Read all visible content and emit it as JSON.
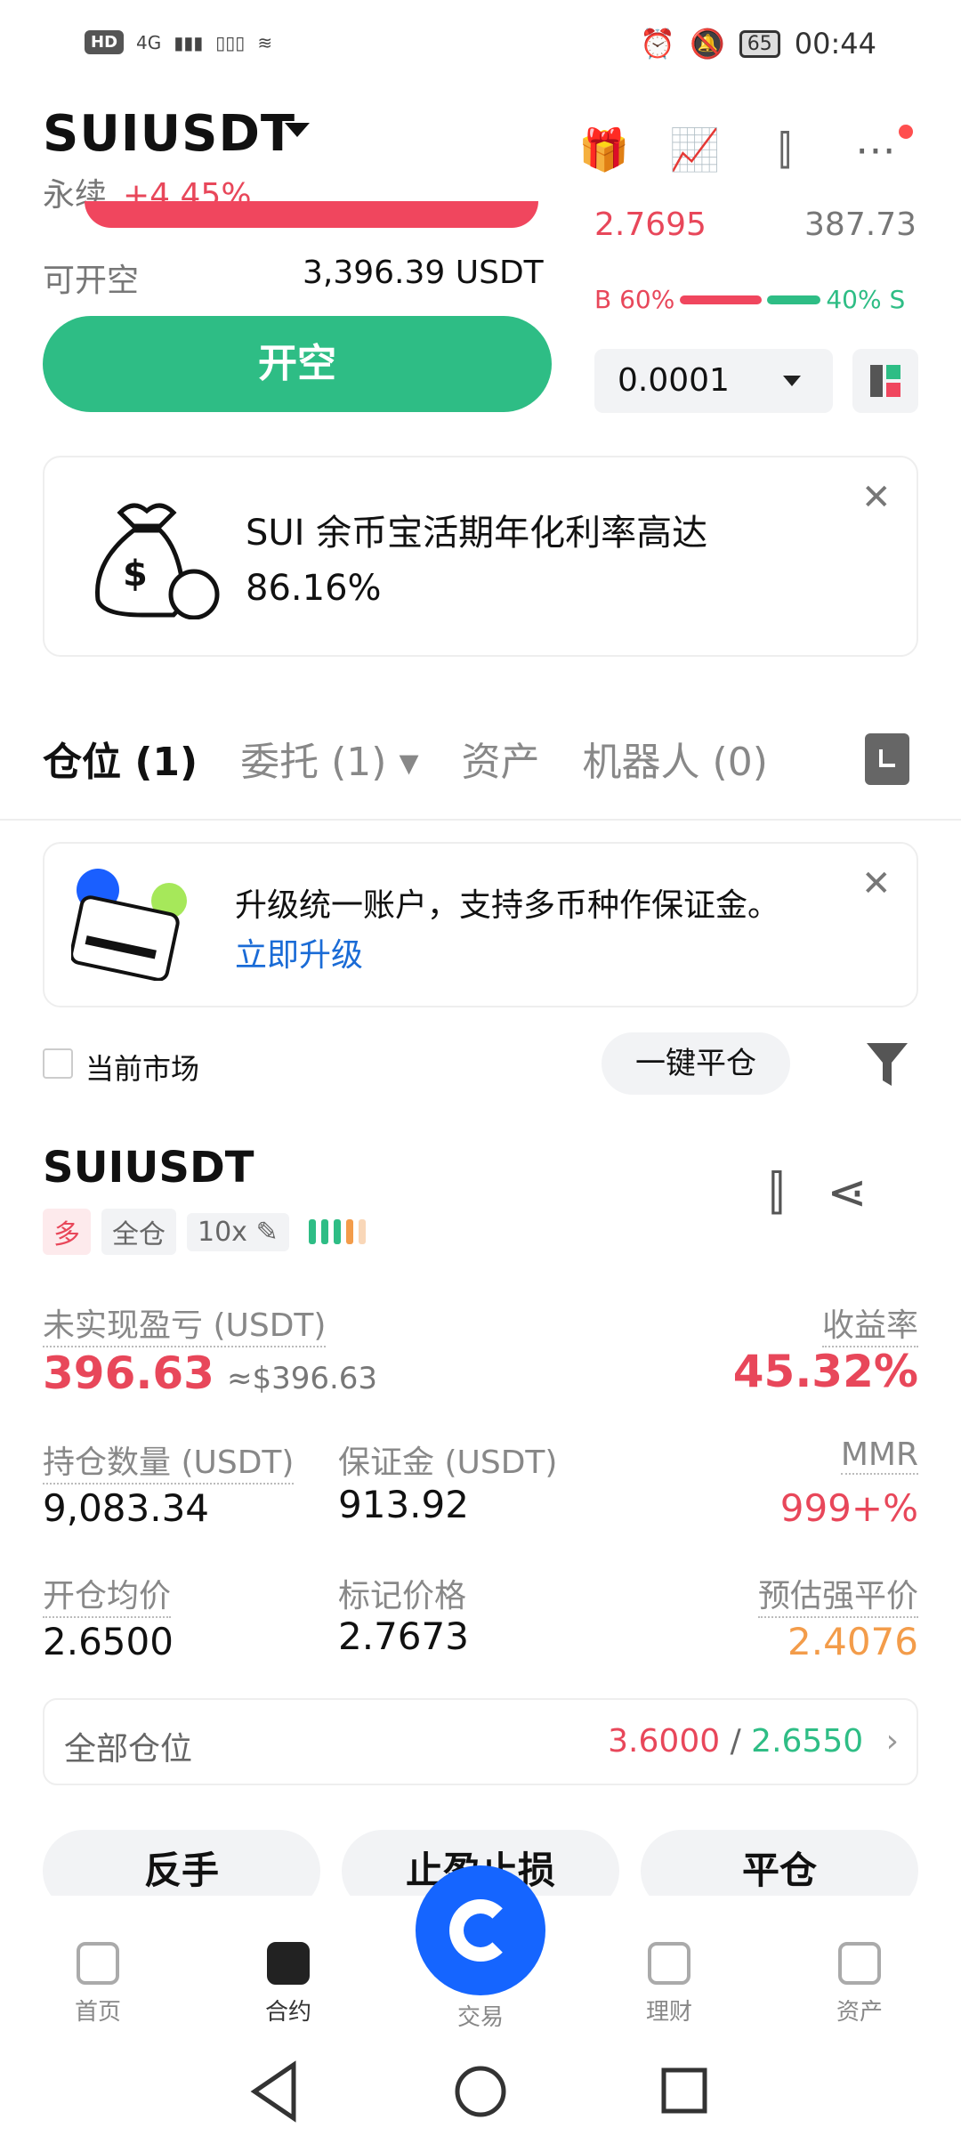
{
  "status_bar": {
    "hd": "HD",
    "net": "4G",
    "battery": "65",
    "time": "00:44"
  },
  "header": {
    "pair": "SUIUSDT",
    "contract_type": "永续",
    "change": "+4.45%"
  },
  "orderbook": {
    "price": "2.7695",
    "qty": "387.73",
    "buy_ratio": "B 60%",
    "sell_ratio": "40% S",
    "buy_fraction": 0.6,
    "sell_fraction": 0.4
  },
  "order": {
    "available_label": "可开空",
    "available_value": "3,396.39 USDT",
    "open_short_label": "开空",
    "depth_value": "0.0001"
  },
  "promo": {
    "line1": "SUI 余币宝活期年化利率高达",
    "line2": "86.16%"
  },
  "tabs": [
    {
      "label": "仓位 (1)"
    },
    {
      "label": "委托 (1)"
    },
    {
      "label": "资产"
    },
    {
      "label": "机器人 (0)"
    }
  ],
  "upgrade": {
    "text": "升级统一账户，支持多币种作保证金。",
    "link": "立即升级"
  },
  "filter": {
    "current_market": "当前市场",
    "close_all": "一键平仓"
  },
  "position": {
    "pair": "SUIUSDT",
    "side_tag": "多",
    "margin_tag": "全仓",
    "leverage_tag": "10x",
    "unrealized_label": "未实现盈亏 (USDT)",
    "unrealized_value": "396.63",
    "unrealized_approx": "≈$396.63",
    "roe_label": "收益率",
    "roe_value": "45.32%",
    "size_label": "持仓数量 (USDT)",
    "size_value": "9,083.34",
    "margin_label": "保证金 (USDT)",
    "margin_value": "913.92",
    "mmr_label": "MMR",
    "mmr_value": "999+%",
    "entry_label": "开仓均价",
    "entry_value": "2.6500",
    "mark_label": "标记价格",
    "mark_value": "2.7673",
    "liq_label": "预估强平价",
    "liq_value": "2.4076",
    "all_positions_label": "全部仓位",
    "tp_value": "3.6000",
    "sl_value": "2.6550",
    "sep": "/"
  },
  "actions": {
    "reverse": "反手",
    "tpsl": "止盈止损",
    "close": "平仓"
  },
  "nav": {
    "home": "首页",
    "contract": "合约",
    "trade": "交易",
    "finance": "理财",
    "assets": "资产"
  }
}
